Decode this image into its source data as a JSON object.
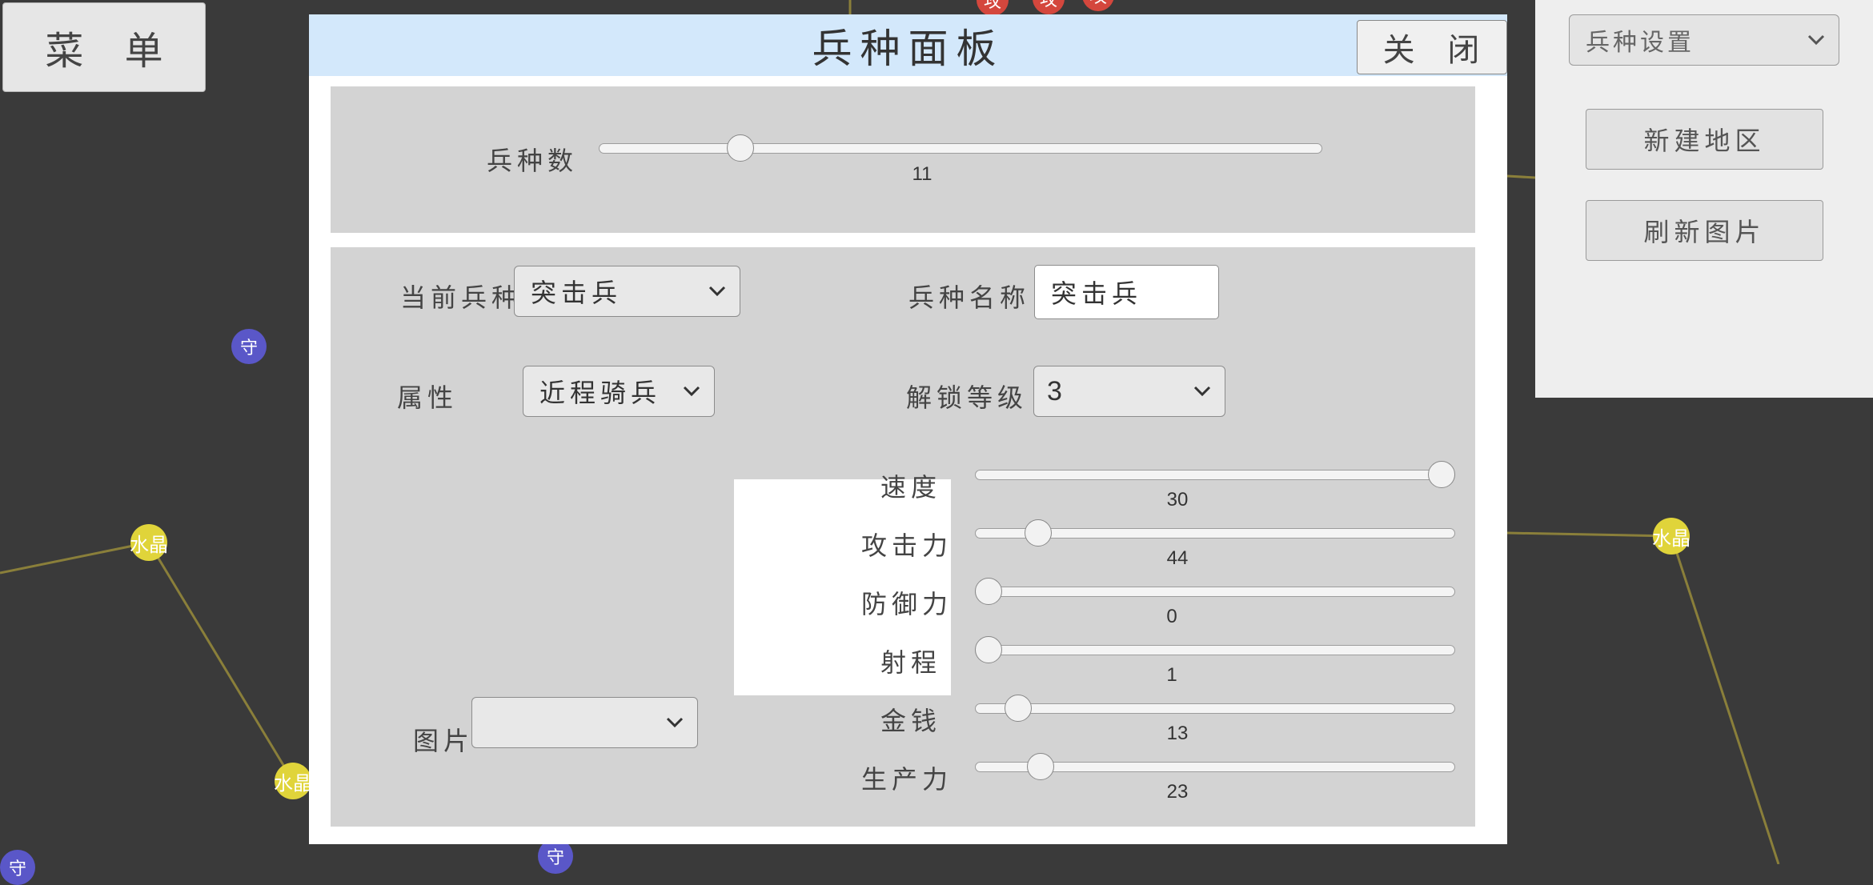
{
  "menu": {
    "label": "菜 单"
  },
  "map": {
    "nodes": [
      {
        "type": "crystal",
        "label": "水晶"
      },
      {
        "type": "crystal",
        "label": "水晶"
      },
      {
        "type": "crystal",
        "label": "水晶"
      },
      {
        "type": "defend",
        "label": "守"
      },
      {
        "type": "defend",
        "label": "守"
      },
      {
        "type": "defend",
        "label": "守"
      },
      {
        "type": "attack",
        "label": "攻"
      },
      {
        "type": "attack",
        "label": "攻"
      },
      {
        "type": "attack",
        "label": "攻"
      }
    ],
    "colors": {
      "line": "#8a7f3a",
      "crystal": "#e0d43a",
      "defend": "#5a57c8",
      "attack": "#d4473d",
      "background": "#3a3a3a"
    }
  },
  "side_panel": {
    "mode_select": {
      "value": "兵种设置"
    },
    "new_region_button": "新建地区",
    "refresh_image_button": "刷新图片"
  },
  "dialog": {
    "title": "兵种面板",
    "close_button": "关 闭",
    "unit_count": {
      "label": "兵种数",
      "value": 11,
      "min": 0,
      "max": 60
    },
    "current_unit": {
      "label": "当前兵种",
      "value": "突击兵"
    },
    "unit_name": {
      "label": "兵种名称",
      "value": "突击兵"
    },
    "attribute": {
      "label": "属性",
      "value": "近程骑兵"
    },
    "unlock_level": {
      "label": "解锁等级",
      "value": "3"
    },
    "image": {
      "label": "图片",
      "value": ""
    },
    "stats": [
      {
        "label": "速度",
        "value": 30,
        "min": 0,
        "max": 30
      },
      {
        "label": "攻击力",
        "value": 44,
        "min": 0,
        "max": 400
      },
      {
        "label": "防御力",
        "value": 0,
        "min": 0,
        "max": 400
      },
      {
        "label": "射程",
        "value": 1,
        "min": 1,
        "max": 100
      },
      {
        "label": "金钱",
        "value": 13,
        "min": 0,
        "max": 200
      },
      {
        "label": "生产力",
        "value": 23,
        "min": 0,
        "max": 200
      }
    ]
  }
}
